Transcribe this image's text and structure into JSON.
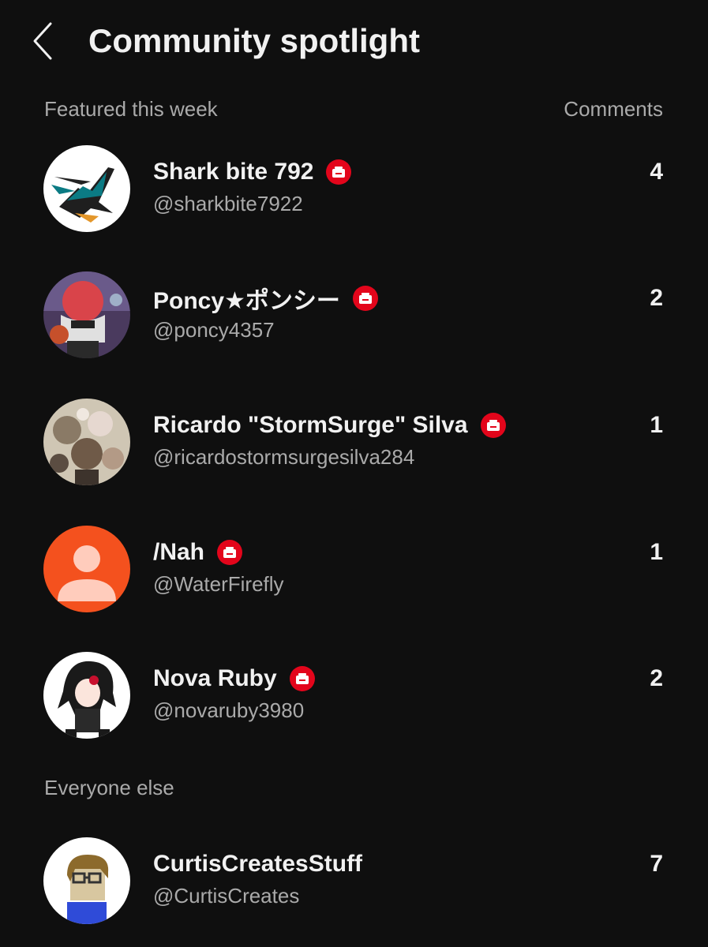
{
  "header": {
    "title": "Community spotlight",
    "back_icon": "chevron-left-icon"
  },
  "featured": {
    "label": "Featured this week",
    "column_label": "Comments",
    "members": [
      {
        "name": "Shark bite 792",
        "handle": "@sharkbite7922",
        "comments": "4",
        "badge": "member-badge-icon"
      },
      {
        "name": "Poncy★ポンシー",
        "handle": "@poncy4357",
        "comments": "2",
        "badge": "member-badge-icon"
      },
      {
        "name": "Ricardo \"StormSurge\" Silva",
        "handle": "@ricardostormsurgesilva284",
        "comments": "1",
        "badge": "member-badge-icon"
      },
      {
        "name": "/Nah",
        "handle": "@WaterFirefly",
        "comments": "1",
        "badge": "member-badge-icon"
      },
      {
        "name": "Nova Ruby",
        "handle": "@novaruby3980",
        "comments": "2",
        "badge": "member-badge-icon"
      }
    ]
  },
  "everyone_else": {
    "label": "Everyone else",
    "members": [
      {
        "name": "CurtisCreatesStuff",
        "handle": "@CurtisCreates",
        "comments": "7"
      }
    ]
  },
  "colors": {
    "background": "#0f0f0f",
    "primary_text": "#f1f1f1",
    "secondary_text": "#aaaaaa",
    "badge": "#e3051b",
    "default_avatar": "#f4511e"
  }
}
